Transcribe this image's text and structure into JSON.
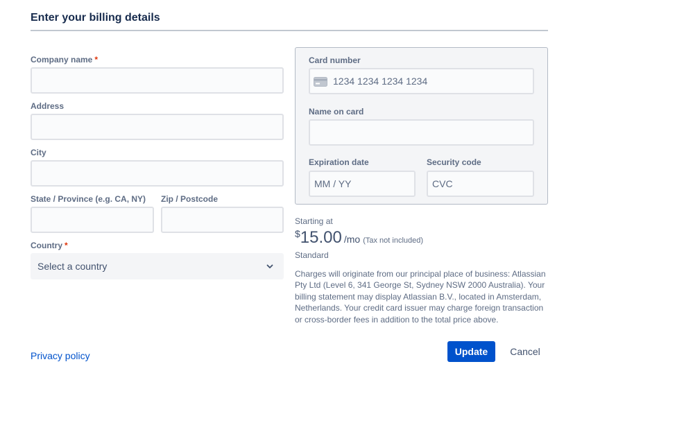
{
  "header": {
    "title": "Enter your billing details"
  },
  "billing": {
    "company_label": "Company name",
    "address_label": "Address",
    "city_label": "City",
    "state_label": "State / Province (e.g. CA, NY)",
    "zip_label": "Zip / Postcode",
    "country_label": "Country",
    "country_placeholder": "Select a country",
    "required_mark": "*"
  },
  "card": {
    "number_label": "Card number",
    "number_placeholder": "1234 1234 1234 1234",
    "name_label": "Name on card",
    "expiry_label": "Expiration date",
    "expiry_placeholder": "MM / YY",
    "security_label": "Security code",
    "security_placeholder": "CVC"
  },
  "pricing": {
    "starting_at": "Starting at",
    "currency": "$",
    "amount": "15.00",
    "period": "/mo",
    "tax_note": "(Tax not included)",
    "plan": "Standard",
    "charges_text": "Charges will originate from our principal place of business: Atlassian Pty Ltd (Level 6, 341 George St, Sydney NSW 2000 Australia). Your billing statement may display Atlassian B.V., located in Amsterdam, Netherlands. Your credit card issuer may charge foreign transaction or cross-border fees in addition to the total price above."
  },
  "footer": {
    "privacy_link": "Privacy policy",
    "update_label": "Update",
    "cancel_label": "Cancel"
  },
  "colors": {
    "primary": "#0052CC",
    "required": "#DE350B",
    "text": "#172B4D",
    "subtle": "#5E6C84"
  },
  "icons": {
    "card": "credit-card-icon",
    "chevron": "chevron-down-icon"
  }
}
